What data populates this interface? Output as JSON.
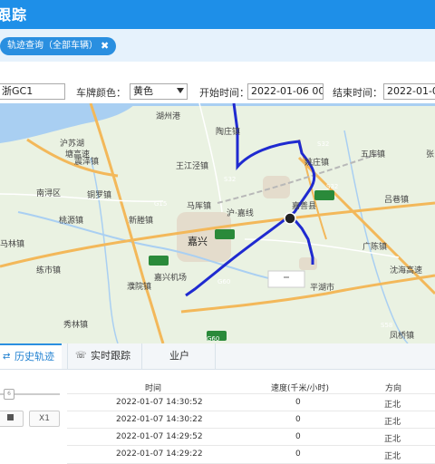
{
  "header": {
    "title": "跟踪"
  },
  "tab_bar": {
    "tab_label": "轨迹查询（全部车辆）",
    "close_symbol": "✖"
  },
  "filter": {
    "plate_value": "浙GC1",
    "plate_color_label": "车牌颜色：",
    "plate_color_value": "黄色",
    "start_label": "开始时间：",
    "start_value": "2022-01-06 00:",
    "end_label": "结束时间：",
    "end_value": "2022-01-0"
  },
  "map": {
    "route_color": "#1f2ad0",
    "places": [
      "湖州港",
      "陶庄镇",
      "S32",
      "五库镇",
      "张",
      "姚庄镇",
      "S32",
      "沪苏湖",
      "塘高速",
      "震泽镇",
      "王江泾镇",
      "S32",
      "嘉善县",
      "吕巷镇",
      "南浔区",
      "铜罗镇",
      "G15",
      "马厍镇",
      "沪·嘉线",
      "嘉兴",
      "新塍镇",
      "桃源镇",
      "马林镇",
      "广陈镇",
      "练市镇",
      "嘉兴机场",
      "平湖市",
      "沈海高速",
      "G60",
      "濮院镇",
      "G60",
      "秀林镇",
      "S58",
      "凤桥镇"
    ]
  },
  "panel": {
    "tabs": [
      "历史轨迹",
      "实时跟踪",
      "业户"
    ],
    "tab_icons": [
      "swap-icon",
      "phone-icon"
    ],
    "speed_button": "X1",
    "slider_value": "6",
    "columns": [
      "时间",
      "速度(千米/小时)",
      "方向"
    ],
    "rows": [
      {
        "time": "2022-01-07 14:30:52",
        "speed": "0",
        "dir": "正北"
      },
      {
        "time": "2022-01-07 14:30:22",
        "speed": "0",
        "dir": "正北"
      },
      {
        "time": "2022-01-07 14:29:52",
        "speed": "0",
        "dir": "正北"
      },
      {
        "time": "2022-01-07 14:29:22",
        "speed": "0",
        "dir": "正北"
      }
    ]
  }
}
